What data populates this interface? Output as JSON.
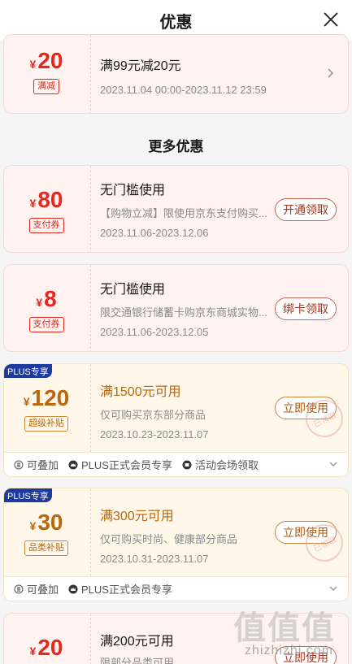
{
  "header": {
    "title": "优惠"
  },
  "top_coupon": {
    "currency": "¥",
    "amount": "20",
    "tag": "满减",
    "title": "满99元减20元",
    "date": "2023.11.04 00:00-2023.11.12 23:59"
  },
  "more_title": "更多优惠",
  "coupons": [
    {
      "currency": "¥",
      "amount": "80",
      "tag": "支付券",
      "title": "无门槛使用",
      "desc": "【购物立减】限使用京东支付购买...",
      "date": "2023.11.06-2023.12.06",
      "action": "开通领取"
    },
    {
      "currency": "¥",
      "amount": "8",
      "tag": "支付券",
      "title": "无门槛使用",
      "desc": "限交通银行储蓄卡购京东商城实物...",
      "date": "2023.11.06-2023.12.05",
      "action": "绑卡领取"
    },
    {
      "badge": "PLUS专享",
      "currency": "¥",
      "amount": "120",
      "tag": "超级补贴",
      "title": "满1500元可用",
      "desc": "仅可购买京东部分商品",
      "date": "2023.10.23-2023.11.07",
      "action": "立即使用",
      "stamp": "已领取",
      "features": [
        "可叠加",
        "PLUS正式会员专享",
        "活动会场领取"
      ]
    },
    {
      "badge": "PLUS专享",
      "currency": "¥",
      "amount": "30",
      "tag": "品类补贴",
      "title": "满300元可用",
      "desc": "仅可购买时尚、健康部分商品",
      "date": "2023.10.31-2023.11.07",
      "action": "立即使用",
      "stamp": "已领取",
      "features": [
        "可叠加",
        "PLUS正式会员专享"
      ]
    },
    {
      "currency": "¥",
      "amount": "20",
      "title": "满200元可用",
      "desc": "限部分品类可用",
      "action": "立即使用"
    }
  ],
  "watermark": {
    "big": "值值值",
    "small": "zhizhizhi.com"
  },
  "colors": {
    "red": "#e6271e",
    "gold": "#b9660c",
    "plus_badge": "#1d3b9c"
  },
  "icons": {
    "close": "close-icon",
    "chevron": "chevron-right-icon",
    "expand": "chevron-down-icon"
  }
}
